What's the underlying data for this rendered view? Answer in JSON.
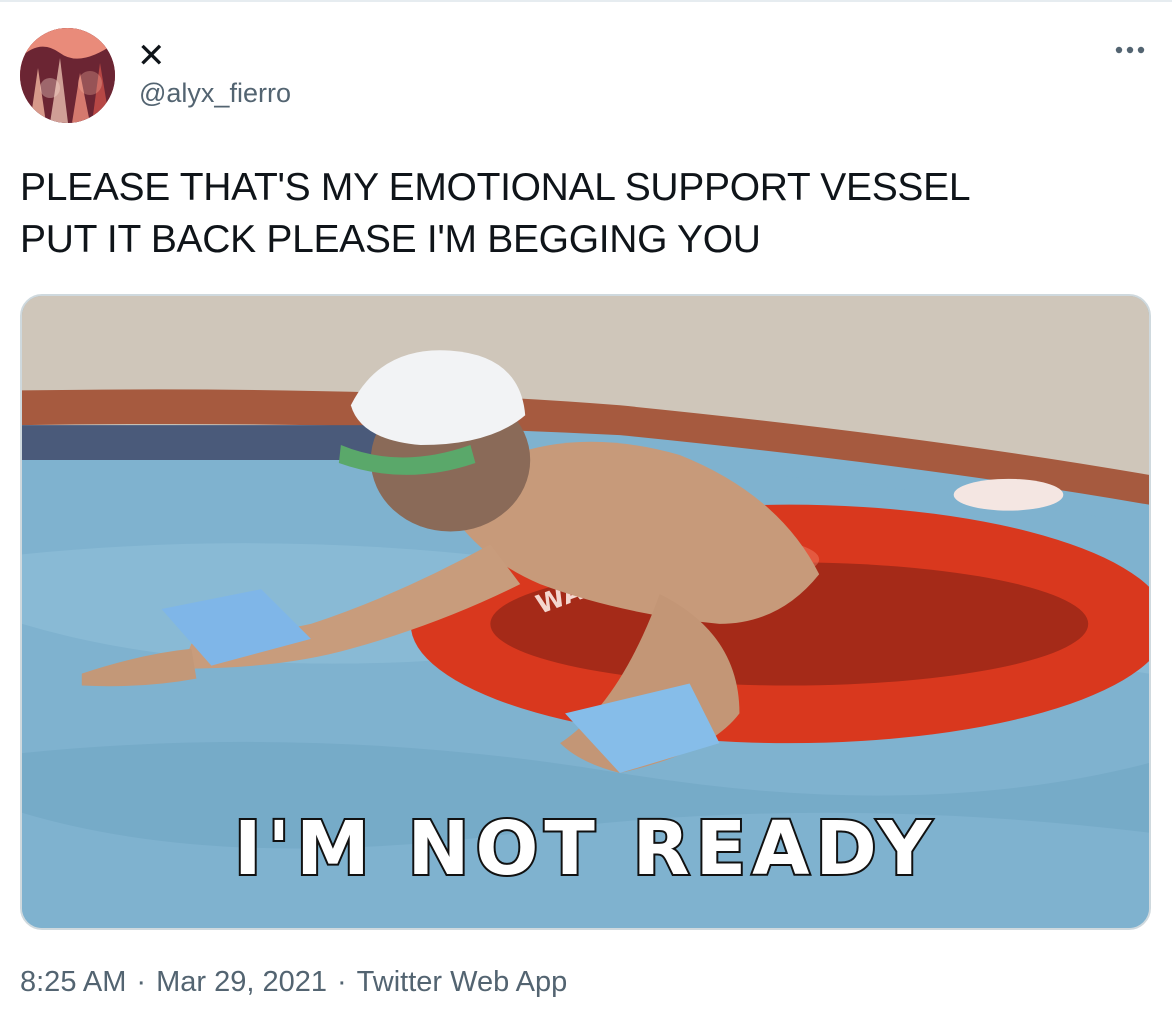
{
  "tweet": {
    "author": {
      "display_name": "✕",
      "handle": "@alyx_fierro",
      "avatar_icon": "avatar-photo"
    },
    "more_icon": "more-dots-icon",
    "text": "PLEASE THAT'S MY EMOTIONAL SUPPORT VESSEL\nPUT IT BACK PLEASE I'M BEGGING YOU",
    "media": {
      "caption": "I'M NOT READY",
      "float_lettering": "WAIKIKI"
    },
    "meta": {
      "time": "8:25 AM",
      "date": "Mar 29, 2021",
      "source": "Twitter Web App",
      "separator": "·"
    }
  },
  "colors": {
    "text_primary": "#0f1419",
    "text_secondary": "#536471",
    "border": "#cfd9de",
    "pool_water": "#7fb2cf",
    "float_red": "#d9381e"
  }
}
